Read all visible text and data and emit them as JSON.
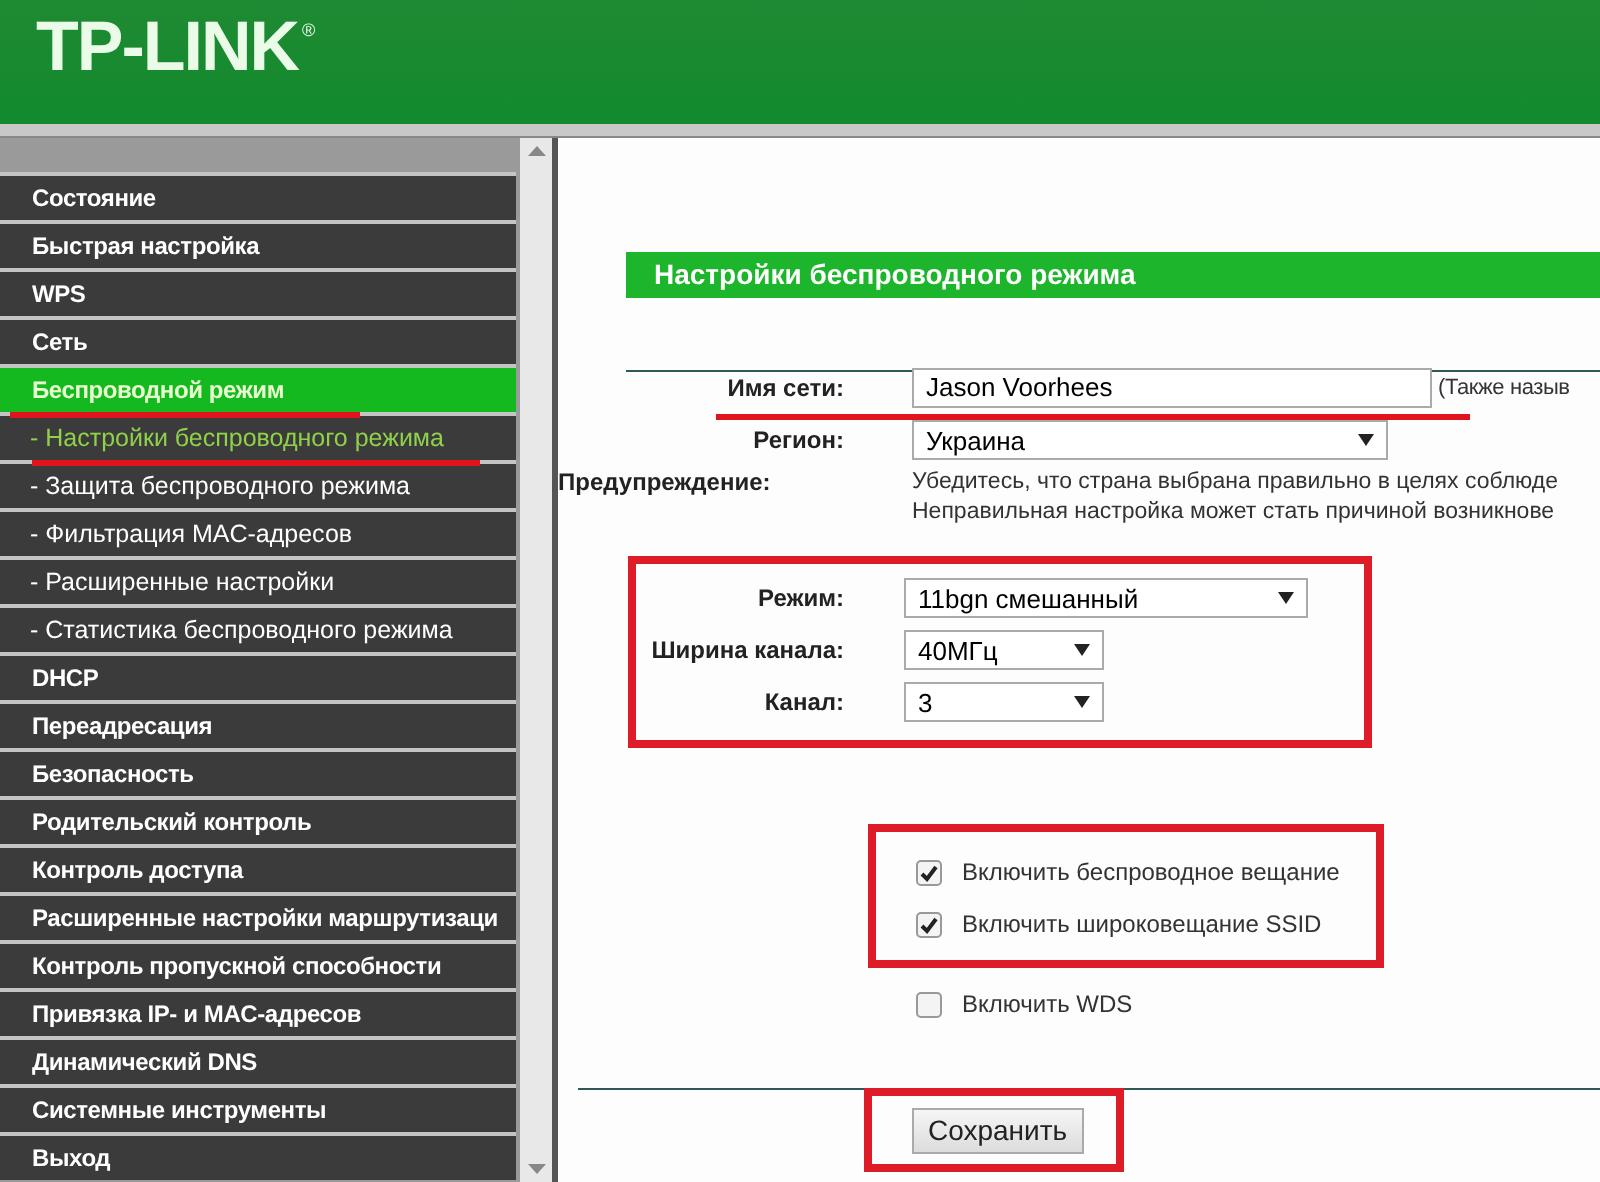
{
  "header": {
    "logo": "TP-LINK",
    "logo_mark": "®"
  },
  "sidebar": {
    "items": [
      {
        "label": "Состояние",
        "selected": false,
        "underlined": false
      },
      {
        "label": "Быстрая настройка",
        "selected": false,
        "underlined": false
      },
      {
        "label": "WPS",
        "selected": false,
        "underlined": false
      },
      {
        "label": "Сеть",
        "selected": false,
        "underlined": false
      },
      {
        "label": "Беспроводной режим",
        "selected": true,
        "underlined": true,
        "children": [
          {
            "label": "- Настройки беспроводного режима",
            "selected": true,
            "underlined": true
          },
          {
            "label": "- Защита беспроводного режима",
            "selected": false,
            "underlined": false
          },
          {
            "label": "- Фильтрация MAC-адресов",
            "selected": false,
            "underlined": false
          },
          {
            "label": "- Расширенные настройки",
            "selected": false,
            "underlined": false
          },
          {
            "label": "- Статистика беспроводного режима",
            "selected": false,
            "underlined": false
          }
        ]
      },
      {
        "label": "DHCP",
        "selected": false,
        "underlined": false
      },
      {
        "label": "Переадресация",
        "selected": false,
        "underlined": false
      },
      {
        "label": "Безопасность",
        "selected": false,
        "underlined": false
      },
      {
        "label": "Родительский контроль",
        "selected": false,
        "underlined": false
      },
      {
        "label": "Контроль доступа",
        "selected": false,
        "underlined": false
      },
      {
        "label": "Расширенные настройки маршрутизаци",
        "selected": false,
        "underlined": false
      },
      {
        "label": "Контроль пропускной способности",
        "selected": false,
        "underlined": false
      },
      {
        "label": "Привязка IP- и MAC-адресов",
        "selected": false,
        "underlined": false
      },
      {
        "label": "Динамический DNS",
        "selected": false,
        "underlined": false
      },
      {
        "label": "Системные инструменты",
        "selected": false,
        "underlined": false
      },
      {
        "label": "Выход",
        "selected": false,
        "underlined": false
      }
    ]
  },
  "form": {
    "title": "Настройки беспроводного режима",
    "ssid": {
      "label": "Имя сети:",
      "value": "Jason Voorhees",
      "note": "(Также назыв",
      "underlined": true
    },
    "region": {
      "label": "Регион:",
      "value": "Украина"
    },
    "warning": {
      "label": "Предупреждение:",
      "lines": [
        "Убедитесь, что страна выбрана правильно в целях соблюде",
        "Неправильная настройка может стать причиной возникнове"
      ]
    },
    "radio_settings": {
      "highlighted": true,
      "fields": [
        {
          "label": "Режим:",
          "value": "11bgn смешанный",
          "kind": "wide"
        },
        {
          "label": "Ширина канала:",
          "value": "40МГц",
          "kind": "narrow"
        },
        {
          "label": "Канал:",
          "value": "3",
          "kind": "narrow"
        }
      ]
    },
    "option_groups": [
      {
        "highlighted": true,
        "options": [
          {
            "label": "Включить беспроводное вещание",
            "checked": true
          },
          {
            "label": "Включить широковещание SSID",
            "checked": true
          }
        ]
      },
      {
        "highlighted": false,
        "options": [
          {
            "label": "Включить WDS",
            "checked": false
          }
        ]
      }
    ],
    "save": {
      "label": "Сохранить",
      "highlighted": true
    }
  }
}
